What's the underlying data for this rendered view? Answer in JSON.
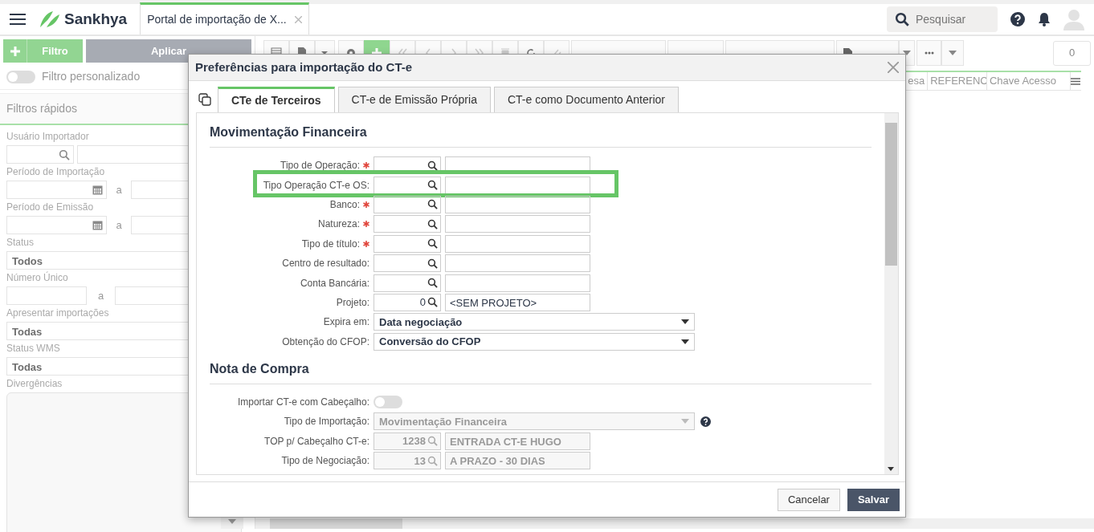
{
  "header": {
    "logo": "Sankhya",
    "tab": {
      "label": "Portal de importação de X...",
      "selected": true
    },
    "search": {
      "placeholder": "Pesquisar"
    }
  },
  "sidebar": {
    "filter_button": "Filtro",
    "apply_button": "Aplicar",
    "custom_filter": {
      "label": "Filtro personalizado",
      "on": false
    },
    "quick_filters_title": "Filtros rápidos",
    "fields": [
      {
        "kind": "lookup",
        "label": "Usuário Importador"
      },
      {
        "kind": "daterange",
        "label": "Período de Importação",
        "separator": "a"
      },
      {
        "kind": "daterange",
        "label": "Período de Emissão",
        "separator": "a"
      },
      {
        "kind": "select",
        "label": "Status",
        "value": "Todos"
      },
      {
        "kind": "numrange",
        "label": "Número Único",
        "separator": "a"
      },
      {
        "kind": "select",
        "label": "Apresentar importações",
        "value": "Todas"
      },
      {
        "kind": "select",
        "label": "Status WMS",
        "value": "Todas"
      },
      {
        "kind": "textarea",
        "label": "Divergências"
      }
    ]
  },
  "toolbar": {
    "counter": "0"
  },
  "grid": {
    "columns": [
      "esa",
      "REFERENC",
      "Chave Acesso"
    ]
  },
  "modal": {
    "title": "Preferências para importação do CT-e",
    "tabs": [
      {
        "label": "CTe de Terceiros",
        "selected": true
      },
      {
        "label": "CT-e de Emissão Própria",
        "selected": false
      },
      {
        "label": "CT-e como Documento Anterior",
        "selected": false
      }
    ],
    "sections": [
      {
        "title": "Movimentação Financeira",
        "rows": [
          {
            "kind": "lookup",
            "label": "Tipo de Operação:",
            "required": true,
            "highlighted": false,
            "disabled": false
          },
          {
            "kind": "lookup",
            "label": "Tipo Operação CT-e OS:",
            "required": false,
            "highlighted": true,
            "disabled": false
          },
          {
            "kind": "lookup",
            "label": "Banco:",
            "required": true,
            "highlighted": false,
            "disabled": false
          },
          {
            "kind": "lookup",
            "label": "Natureza:",
            "required": true,
            "highlighted": false,
            "disabled": false
          },
          {
            "kind": "lookup",
            "label": "Tipo de título:",
            "required": true,
            "highlighted": false,
            "disabled": false
          },
          {
            "kind": "lookup",
            "label": "Centro de resultado:",
            "required": false,
            "highlighted": false,
            "disabled": false
          },
          {
            "kind": "lookup",
            "label": "Conta Bancária:",
            "required": false,
            "highlighted": false,
            "disabled": false
          },
          {
            "kind": "lookup",
            "label": "Projeto:",
            "required": false,
            "highlighted": false,
            "disabled": false,
            "code": "0",
            "description": "<SEM PROJETO>"
          },
          {
            "kind": "select",
            "label": "Expira em:",
            "value": "Data negociação",
            "disabled": false
          },
          {
            "kind": "select",
            "label": "Obtenção do CFOP:",
            "value": "Conversão do CFOP",
            "disabled": false
          }
        ]
      },
      {
        "title": "Nota de Compra",
        "rows": [
          {
            "kind": "toggle",
            "label": "Importar CT-e com Cabeçalho:",
            "on": false
          },
          {
            "kind": "select",
            "label": "Tipo de Importação:",
            "value": "Movimentação Financeira",
            "disabled": true,
            "help": true
          },
          {
            "kind": "lookup",
            "label": "TOP p/ Cabeçalho CT-e:",
            "required": false,
            "highlighted": false,
            "disabled": true,
            "code": "1238",
            "description": "ENTRADA CT-E HUGO"
          },
          {
            "kind": "lookup",
            "label": "Tipo de Negociação:",
            "required": false,
            "highlighted": false,
            "disabled": true,
            "code": "13",
            "description": "A PRAZO - 30 DIAS"
          }
        ]
      }
    ],
    "buttons": [
      {
        "label": "Cancelar",
        "kind": "secondary"
      },
      {
        "label": "Salvar",
        "kind": "primary"
      }
    ]
  }
}
